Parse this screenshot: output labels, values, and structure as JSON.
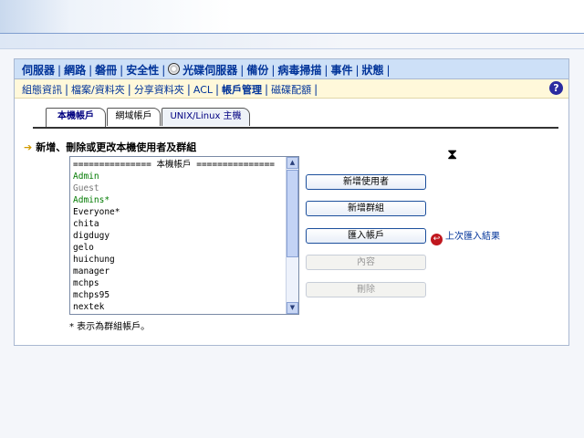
{
  "nav_main": {
    "items": [
      "伺服器",
      "網路",
      "磐冊",
      "安全性",
      "光碟伺服器",
      "備份",
      "病毒掃描",
      "事件",
      "狀態"
    ]
  },
  "nav_sub": {
    "items": [
      "組態資訊",
      "檔案/資料夾",
      "分享資料夾",
      "ACL",
      "帳戶管理",
      "磁碟配額"
    ],
    "active": "帳戶管理"
  },
  "tabs": [
    "本機帳戶",
    "網域帳戶",
    "UNIX/Linux 主機"
  ],
  "section": {
    "title": "新增、刪除或更改本機使用者及群組"
  },
  "listbox": {
    "header": "=============== 本機帳戶 ===============",
    "items": [
      {
        "label": "Admin",
        "color": "#007a00"
      },
      {
        "label": "Guest",
        "color": "#777777"
      },
      {
        "label": "Admins*",
        "color": "#007a00"
      },
      {
        "label": "Everyone*",
        "color": "#000000"
      },
      {
        "label": "chita",
        "color": "#000000"
      },
      {
        "label": "digdugy",
        "color": "#000000"
      },
      {
        "label": "gelo",
        "color": "#000000"
      },
      {
        "label": "huichung",
        "color": "#000000"
      },
      {
        "label": "manager",
        "color": "#000000"
      },
      {
        "label": "mchps",
        "color": "#000000"
      },
      {
        "label": "mchps95",
        "color": "#000000"
      },
      {
        "label": "nextek",
        "color": "#000000"
      }
    ]
  },
  "buttons": {
    "add_user": "新增使用者",
    "add_group": "新增群組",
    "import": "匯入帳戶",
    "properties": "內容",
    "delete": "刪除"
  },
  "last_import_link": "上次匯入結果",
  "footnote": "* 表示為群組帳戶。",
  "icons": {
    "help": "?",
    "arrow": "➔",
    "hourglass": "⧗",
    "back": "↩"
  }
}
